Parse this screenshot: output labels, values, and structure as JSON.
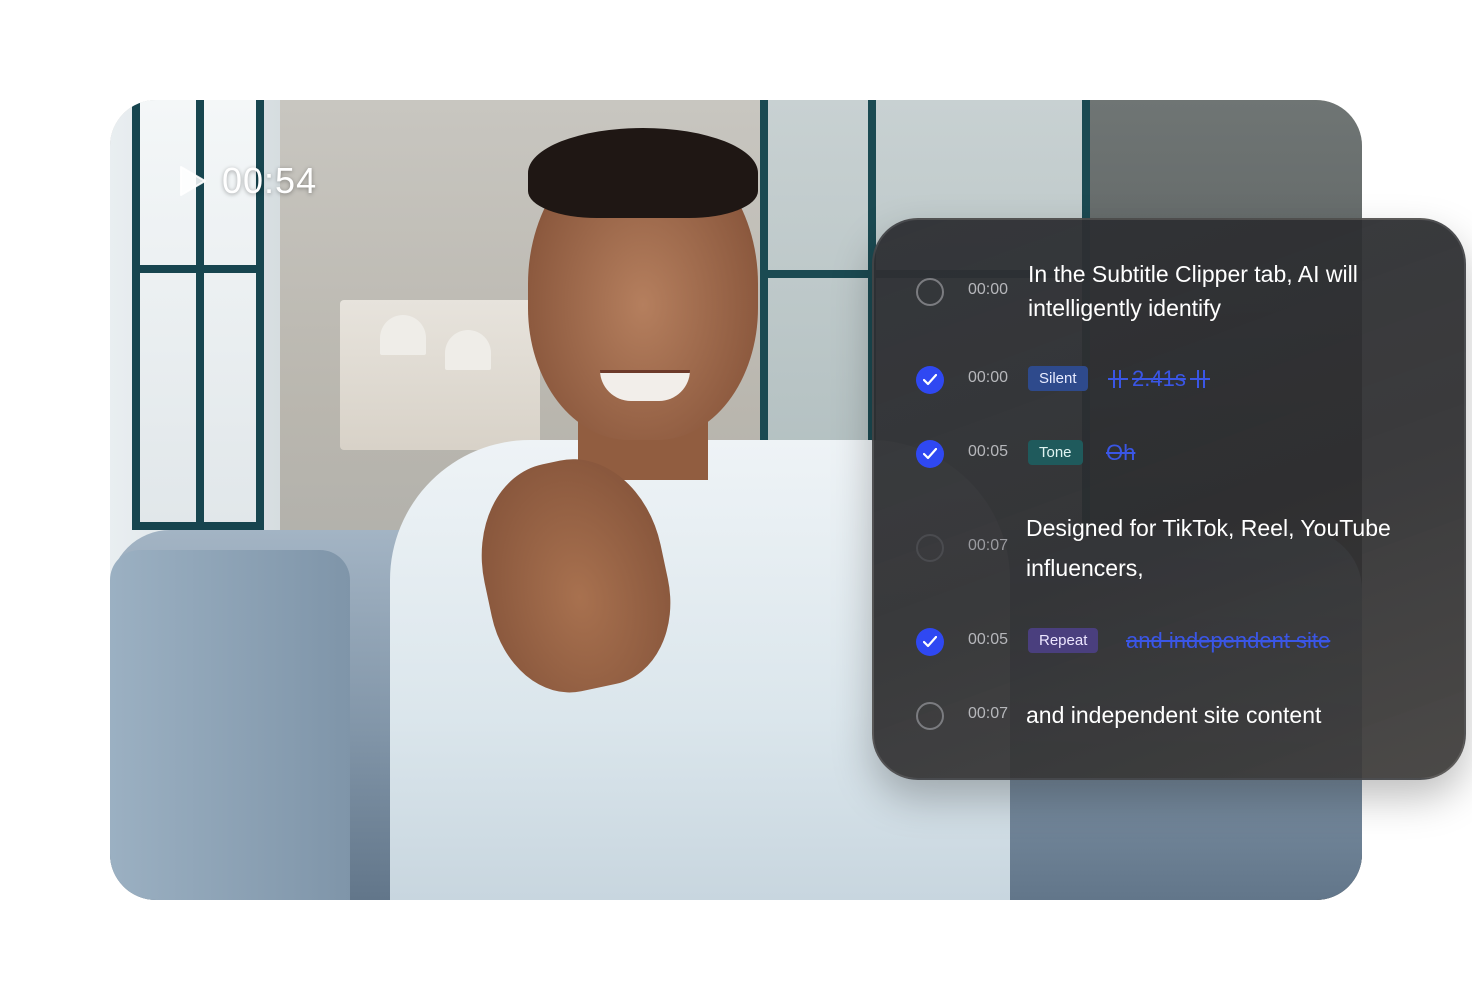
{
  "video": {
    "timestamp": "00:54"
  },
  "panel": {
    "rows": [
      {
        "checked": false,
        "time": "00:00",
        "text": "In the Subtitle Clipper tab, AI will intelligently identify"
      },
      {
        "checked": true,
        "time": "00:00",
        "tag": "Silent",
        "cut": "2.41s"
      },
      {
        "checked": true,
        "time": "00:05",
        "tag": "Tone",
        "cut": "Oh"
      },
      {
        "checked": false,
        "time": "00:07",
        "text": "Designed for TikTok, Reel, YouTube influencers,"
      },
      {
        "checked": true,
        "time": "00:05",
        "tag": "Repeat",
        "cut": "and independent site"
      },
      {
        "checked": false,
        "time": "00:07",
        "text": "and independent site content"
      }
    ]
  },
  "colors": {
    "check_active": "#2f48f2",
    "strike_text": "#3a56e6",
    "tag_silent": "#2e4a8c",
    "tag_tone": "#1f5a5c",
    "tag_repeat": "#4a3f7e"
  },
  "icons": {
    "play": "play-icon",
    "check": "checkmark-icon",
    "silence_marker": "silence-marker-icon"
  }
}
